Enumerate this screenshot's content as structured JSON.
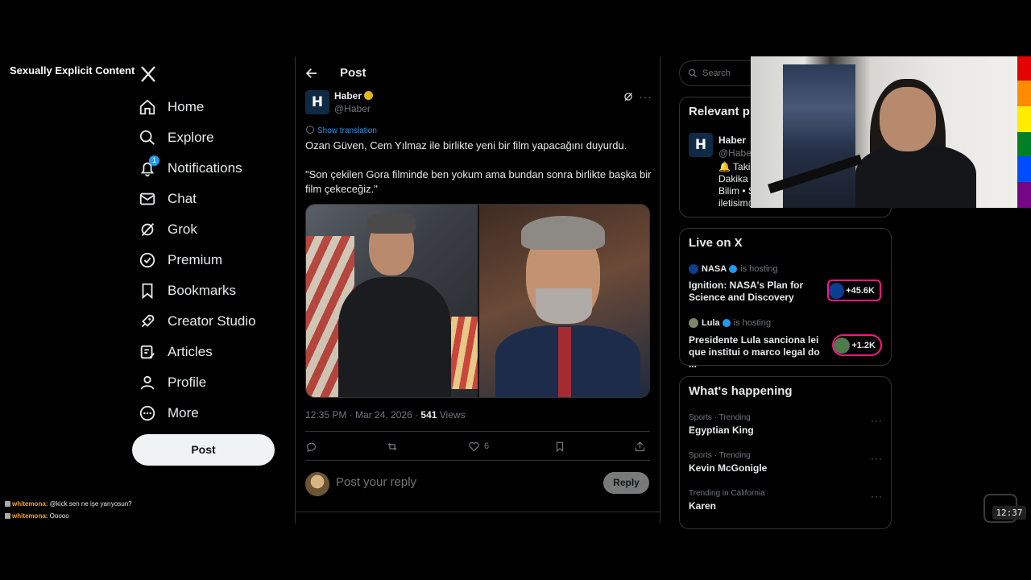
{
  "overlay": {
    "content_warning": "Sexually Explicit Content"
  },
  "nav": {
    "items": [
      {
        "label": "Home",
        "icon": "home-icon"
      },
      {
        "label": "Explore",
        "icon": "search-icon"
      },
      {
        "label": "Notifications",
        "icon": "bell-icon",
        "badge": "1"
      },
      {
        "label": "Chat",
        "icon": "mail-icon"
      },
      {
        "label": "Grok",
        "icon": "grok-icon"
      },
      {
        "label": "Premium",
        "icon": "premium-icon"
      },
      {
        "label": "Bookmarks",
        "icon": "bookmark-icon"
      },
      {
        "label": "Creator Studio",
        "icon": "rocket-icon"
      },
      {
        "label": "Articles",
        "icon": "article-icon"
      },
      {
        "label": "Profile",
        "icon": "person-icon"
      },
      {
        "label": "More",
        "icon": "more-circle-icon"
      }
    ],
    "post_button": "Post"
  },
  "header": {
    "title": "Post"
  },
  "tweet": {
    "author_name": "Haber",
    "author_handle": "@Haber",
    "avatar_letter": "H",
    "show_translation": "Show translation",
    "text_1": "Ozan Güven, Cem Yılmaz ile birlikte yeni bir film yapacağını duyurdu.",
    "text_2": "\"Son çekilen Gora filminde ben yokum ama bundan sonra birlikte başka bir film çekeceğiz.\"",
    "time": "12:35 PM · Mar 24, 2026 · ",
    "views_count": "541",
    "views_label": " Views",
    "like_count": "6"
  },
  "reply": {
    "placeholder": "Post your reply",
    "button": "Reply"
  },
  "search": {
    "placeholder": "Search"
  },
  "relevant": {
    "title": "Relevant p",
    "name": "Haber",
    "handle": "@Haber",
    "bio_1": "🔔 Takip",
    "bio_2": "Dakika •",
    "bio_3": "Bilim • S",
    "bio_4": "iletisim@"
  },
  "live": {
    "title": "Live on X",
    "items": [
      {
        "host": "NASA",
        "hosting": "is hosting",
        "text": "Ignition: NASA's Plan for Science and Discovery",
        "count": "+45.6K"
      },
      {
        "host": "Lula",
        "hosting": "is hosting",
        "text": "Presidente Lula sanciona lei que institui o marco legal do ...",
        "count": "+1.2K"
      }
    ]
  },
  "happening": {
    "title": "What's happening",
    "trends": [
      {
        "category": "Sports · Trending",
        "name": "Egyptian King"
      },
      {
        "category": "Sports · Trending",
        "name": "Kevin McGonigle"
      },
      {
        "category": "Trending in California",
        "name": "Karen"
      }
    ]
  },
  "chat": {
    "messages": [
      {
        "user": "whitemona:",
        "text": " @kick sen ne işe yarıyosun?"
      },
      {
        "user": "whitemona:",
        "text": " Ooooo"
      }
    ]
  },
  "clock": "12:37",
  "colors": {
    "accent": "#1d9bf0",
    "live_pill": "#f91880",
    "verified_gold": "#e2b719"
  }
}
